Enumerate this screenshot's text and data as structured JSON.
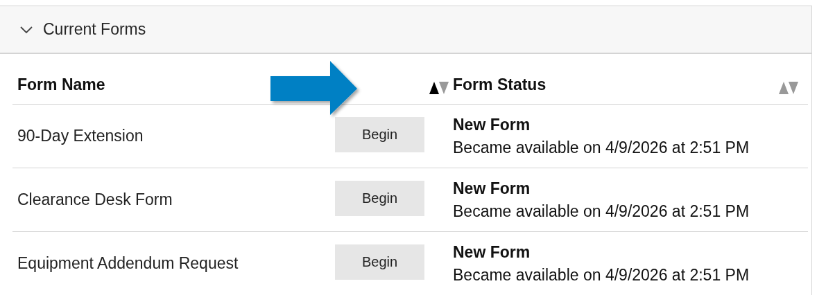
{
  "panel": {
    "title": "Current Forms",
    "expanded": true
  },
  "table": {
    "columns": [
      {
        "label": "Form Name",
        "sorted": true
      },
      {
        "label": "Form Status",
        "sorted": false
      }
    ],
    "rows": [
      {
        "name": "90-Day Extension",
        "action": "Begin",
        "status": "New Form",
        "detail": "Became available on 4/9/2026 at 2:51 PM"
      },
      {
        "name": "Clearance Desk Form",
        "action": "Begin",
        "status": "New Form",
        "detail": "Became available on 4/9/2026 at 2:51 PM"
      },
      {
        "name": "Equipment Addendum Request",
        "action": "Begin",
        "status": "New Form",
        "detail": "Became available on 4/9/2026 at 2:51 PM"
      }
    ]
  },
  "annotation": {
    "kind": "arrow"
  }
}
